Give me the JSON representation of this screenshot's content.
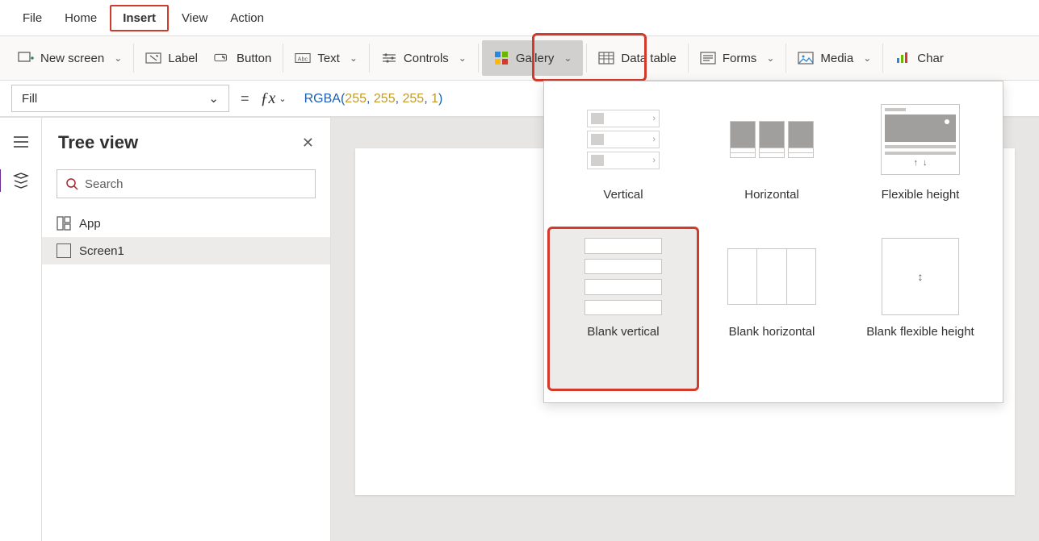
{
  "menu": {
    "file": "File",
    "home": "Home",
    "insert": "Insert",
    "view": "View",
    "action": "Action"
  },
  "ribbon": {
    "newscreen": "New screen",
    "label": "Label",
    "button": "Button",
    "text": "Text",
    "controls": "Controls",
    "gallery": "Gallery",
    "datatable": "Data table",
    "forms": "Forms",
    "media": "Media",
    "charts": "Char"
  },
  "formula": {
    "property": "Fill",
    "fn": "RGBA",
    "a1": "255",
    "a2": "255",
    "a3": "255",
    "a4": "1"
  },
  "tree": {
    "title": "Tree view",
    "search_placeholder": "Search",
    "items": [
      {
        "label": "App"
      },
      {
        "label": "Screen1"
      }
    ]
  },
  "gallery_menu": {
    "vertical": "Vertical",
    "horizontal": "Horizontal",
    "flexible": "Flexible height",
    "blank_v": "Blank vertical",
    "blank_h": "Blank horizontal",
    "blank_flex": "Blank flexible height"
  }
}
